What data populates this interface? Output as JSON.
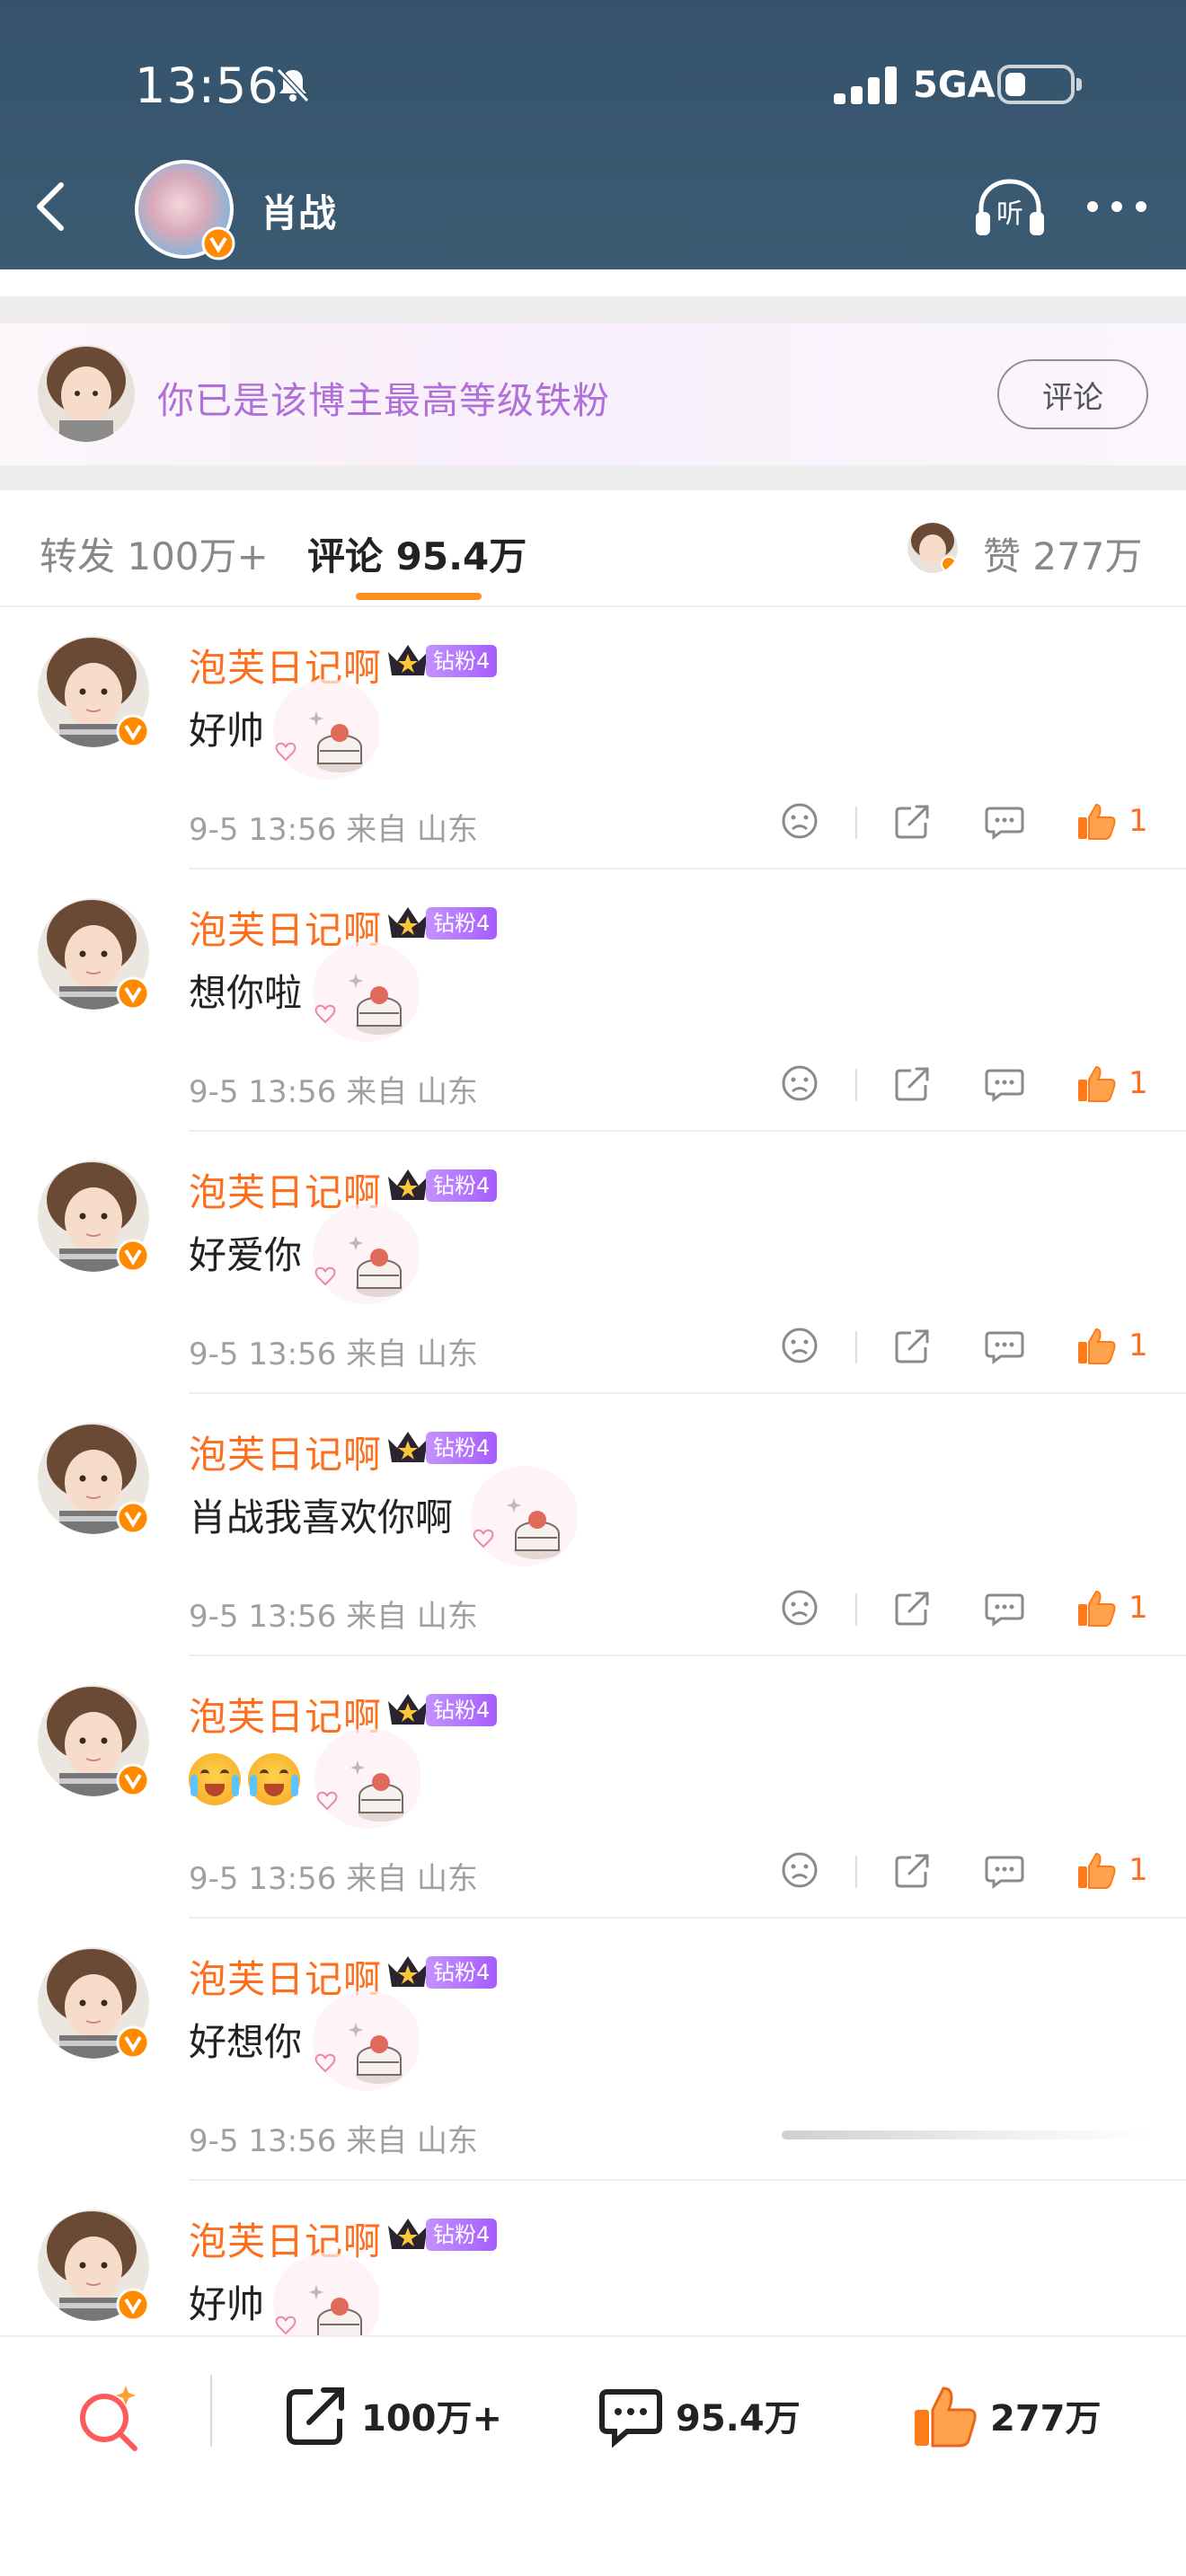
{
  "status_bar": {
    "time": "13:56",
    "network": "5GA"
  },
  "header": {
    "title": "肖战",
    "listen_label": "听"
  },
  "fan_banner": {
    "text": "你已是该博主最高等级铁粉",
    "button": "评论"
  },
  "tabs": {
    "repost": "转发 100万+",
    "comment": "评论 95.4万",
    "like": "赞 277万"
  },
  "comments": [
    {
      "name": "泡芙日记啊",
      "badge": "钻粉4",
      "text": "好帅",
      "meta": "9-5 13:56 来自 山东",
      "likes": "1"
    },
    {
      "name": "泡芙日记啊",
      "badge": "钻粉4",
      "text": "想你啦",
      "meta": "9-5 13:56 来自 山东",
      "likes": "1"
    },
    {
      "name": "泡芙日记啊",
      "badge": "钻粉4",
      "text": "好爱你",
      "meta": "9-5 13:56 来自 山东",
      "likes": "1"
    },
    {
      "name": "泡芙日记啊",
      "badge": "钻粉4",
      "text": "肖战我喜欢你啊",
      "meta": "9-5 13:56 来自 山东",
      "likes": "1"
    },
    {
      "name": "泡芙日记啊",
      "badge": "钻粉4",
      "text": "",
      "emoji": [
        "crying-laughing-face",
        "crying-laughing-face"
      ],
      "meta": "9-5 13:56 来自 山东",
      "likes": "1"
    },
    {
      "name": "泡芙日记啊",
      "badge": "钻粉4",
      "text": "好想你",
      "meta": "9-5 13:56 来自 山东",
      "likes": ""
    },
    {
      "name": "泡芙日记啊",
      "badge": "钻粉4",
      "text": "好帅",
      "meta": "",
      "likes": ""
    }
  ],
  "bottom_bar": {
    "repost_count": "100万+",
    "comment_count": "95.4万",
    "like_count": "277万"
  },
  "colors": {
    "header_bg": "#3a586f",
    "accent_orange": "#ff6e1c",
    "fan_text_purple": "#b06fd9",
    "badge_purple": "#a65cff"
  },
  "icons": [
    "back-icon",
    "bell-muted-icon",
    "headphones-icon",
    "more-icon",
    "verified-icon",
    "crown-icon",
    "sad-face-icon",
    "share-icon",
    "reply-icon",
    "thumbs-up-icon",
    "search-spark-icon"
  ]
}
